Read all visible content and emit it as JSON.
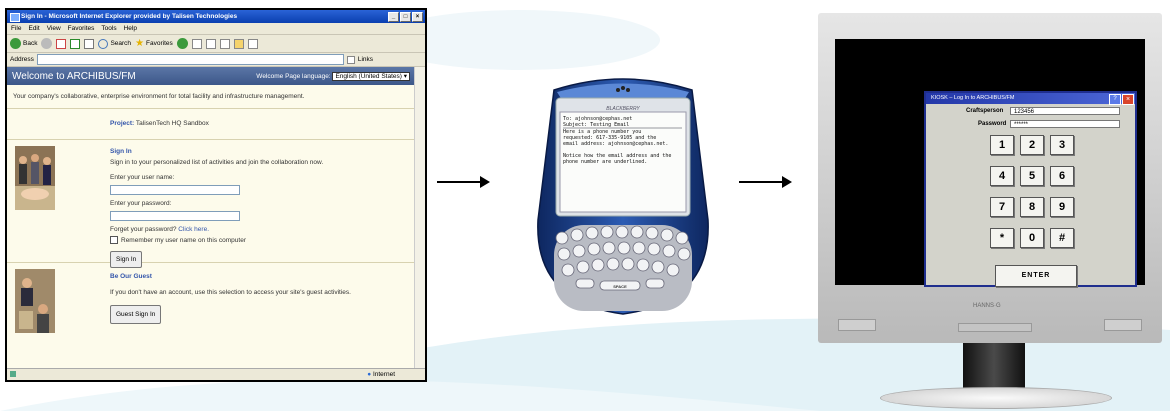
{
  "browser": {
    "window_title": "Sign In - Microsoft Internet Explorer provided by Talisen Technologies",
    "menu": [
      "File",
      "Edit",
      "View",
      "Favorites",
      "Tools",
      "Help"
    ],
    "toolbar": {
      "back": "Back",
      "search": "Search",
      "favorites": "Favorites",
      "links": "Links"
    },
    "address_label": "Address",
    "status_zone": "Internet"
  },
  "page": {
    "header_title": "Welcome to ARCHIBUS/FM",
    "language_label": "Welcome Page language:",
    "language_value": "English (United States)",
    "tagline": "Your company's collaborative, enterprise environment for total facility and infrastructure management.",
    "project_label": "Project:",
    "project_value": "TalisenTech HQ Sandbox",
    "signin": {
      "heading": "Sign In",
      "description": "Sign in to your personalized list of activities and join the collaboration now.",
      "username_label": "Enter your user name:",
      "password_label": "Enter your password:",
      "forgot_label": "Forget your password?",
      "forgot_link": "Click here.",
      "remember_label": "Remember my user name on this computer",
      "button": "Sign In"
    },
    "guest": {
      "heading": "Be Our Guest",
      "description": "If you don't have an account, use this selection to access your site's guest activities.",
      "button": "Guest Sign In"
    }
  },
  "phone": {
    "brand": "BLACKBERRY",
    "email_lines": [
      "To: ajohnson@cephas.net",
      "Subject: Testing Email",
      "Here is a phone number you",
      "requested: 617-335-9105 and the",
      "email address: ajohnson@cephas.net.",
      "",
      "Notice how the email address and the",
      "phone number are underlined."
    ],
    "space_key": "SPACE"
  },
  "kiosk": {
    "title": "KIOSK – Log In to ARCHIBUS/FM",
    "craftsperson_label": "Craftsperson",
    "craftsperson_value": "123456",
    "password_label": "Password",
    "password_value": "******",
    "keys": [
      "1",
      "2",
      "3",
      "4",
      "5",
      "6",
      "7",
      "8",
      "9",
      "*",
      "0",
      "#"
    ],
    "enter_label": "ENTER",
    "monitor_brand": "HANNS·G"
  },
  "colors": {
    "ie_header": "#3c5789",
    "link_blue": "#3355aa",
    "kiosk_title": "#2337a8",
    "phone_body": "#1e3f86"
  }
}
